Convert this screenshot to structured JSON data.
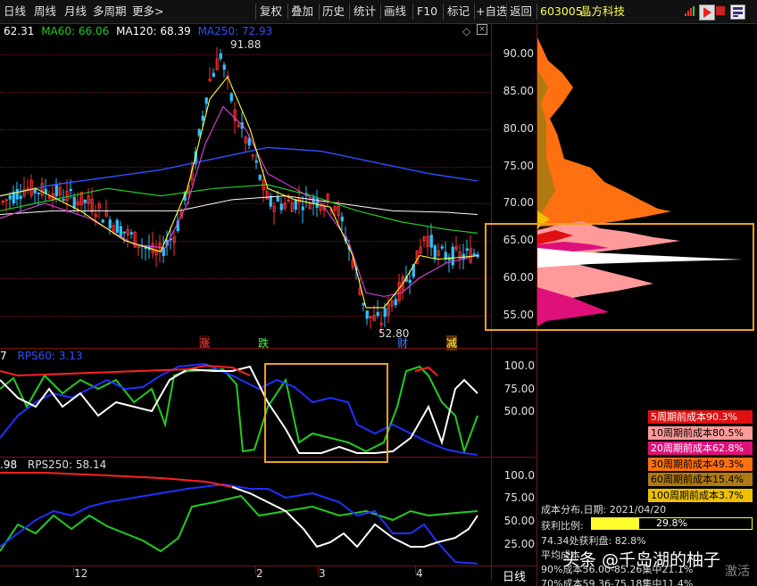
{
  "toolbar": {
    "tabs": [
      "日线",
      "周线",
      "月线",
      "多周期",
      "更多>"
    ],
    "buttons": [
      "复权",
      "叠加",
      "历史",
      "统计",
      "画线",
      "F10",
      "标记",
      "+自选",
      "返回"
    ],
    "stock_code": "603005",
    "stock_name": "晶方科技"
  },
  "ma_legend": {
    "ma_partial": "62.31",
    "ma60": "MA60: 66.06",
    "ma120": "MA120: 68.39",
    "ma250": "MA250: 72.93"
  },
  "price_axis": [
    "90.00",
    "85.00",
    "80.00",
    "75.00",
    "70.00",
    "65.00",
    "60.00",
    "55.00"
  ],
  "annotations": {
    "high": "91.88",
    "low": "52.80",
    "mark_up": "涨",
    "mark_down": "跌",
    "mark_fin": "财",
    "mark_cut": "减"
  },
  "rps60": {
    "label_left": "7",
    "label": "RPS60: 3.13",
    "axis": [
      "100.0",
      "75.00",
      "50.00"
    ]
  },
  "rps250": {
    "label_left": ".98",
    "label": "RPS250: 58.14",
    "axis": [
      "100.0",
      "75.00",
      "50.00",
      "25.00"
    ]
  },
  "time_axis": [
    "12",
    "2",
    "3",
    "4"
  ],
  "bottom_right": "日线",
  "cost_legend": [
    {
      "label": "5周期前成本90.3%",
      "bg": "#e01010",
      "fg": "#ffffff"
    },
    {
      "label": "10周期前成本80.5%",
      "bg": "#ff9a9a",
      "fg": "#000000"
    },
    {
      "label": "20周期前成本62.8%",
      "bg": "#e0107a",
      "fg": "#ffffff"
    },
    {
      "label": "30周期前成本49.3%",
      "bg": "#ff7010",
      "fg": "#000000"
    },
    {
      "label": "60周期前成本15.4%",
      "bg": "#b07a10",
      "fg": "#000000"
    },
    {
      "label": "100周期前成本3.7%",
      "bg": "#f0c000",
      "fg": "#000000"
    }
  ],
  "cost_info": {
    "date_line": "成本分布,日期:  2021/04/20",
    "profit_label": "获利比例:",
    "profit_value": "29.8%",
    "profit_fraction": 0.298,
    "line3": "74.34处获利盘:  82.8%",
    "line4": "平均成本   ",
    "line5": "90%成本56.00-85.26集中21.1%",
    "line6": "70%成本59.36-75.18集中11.4%"
  },
  "watermark": "头条 @千岛湖的柚子",
  "watermark2": "激活",
  "colors": {
    "ma_white": "#ffffff",
    "ma60": "#22cc22",
    "ma120": "#e040e0",
    "ma250": "#3050ff",
    "yellow": "#ffff30",
    "highlight": "#f0a020"
  }
}
